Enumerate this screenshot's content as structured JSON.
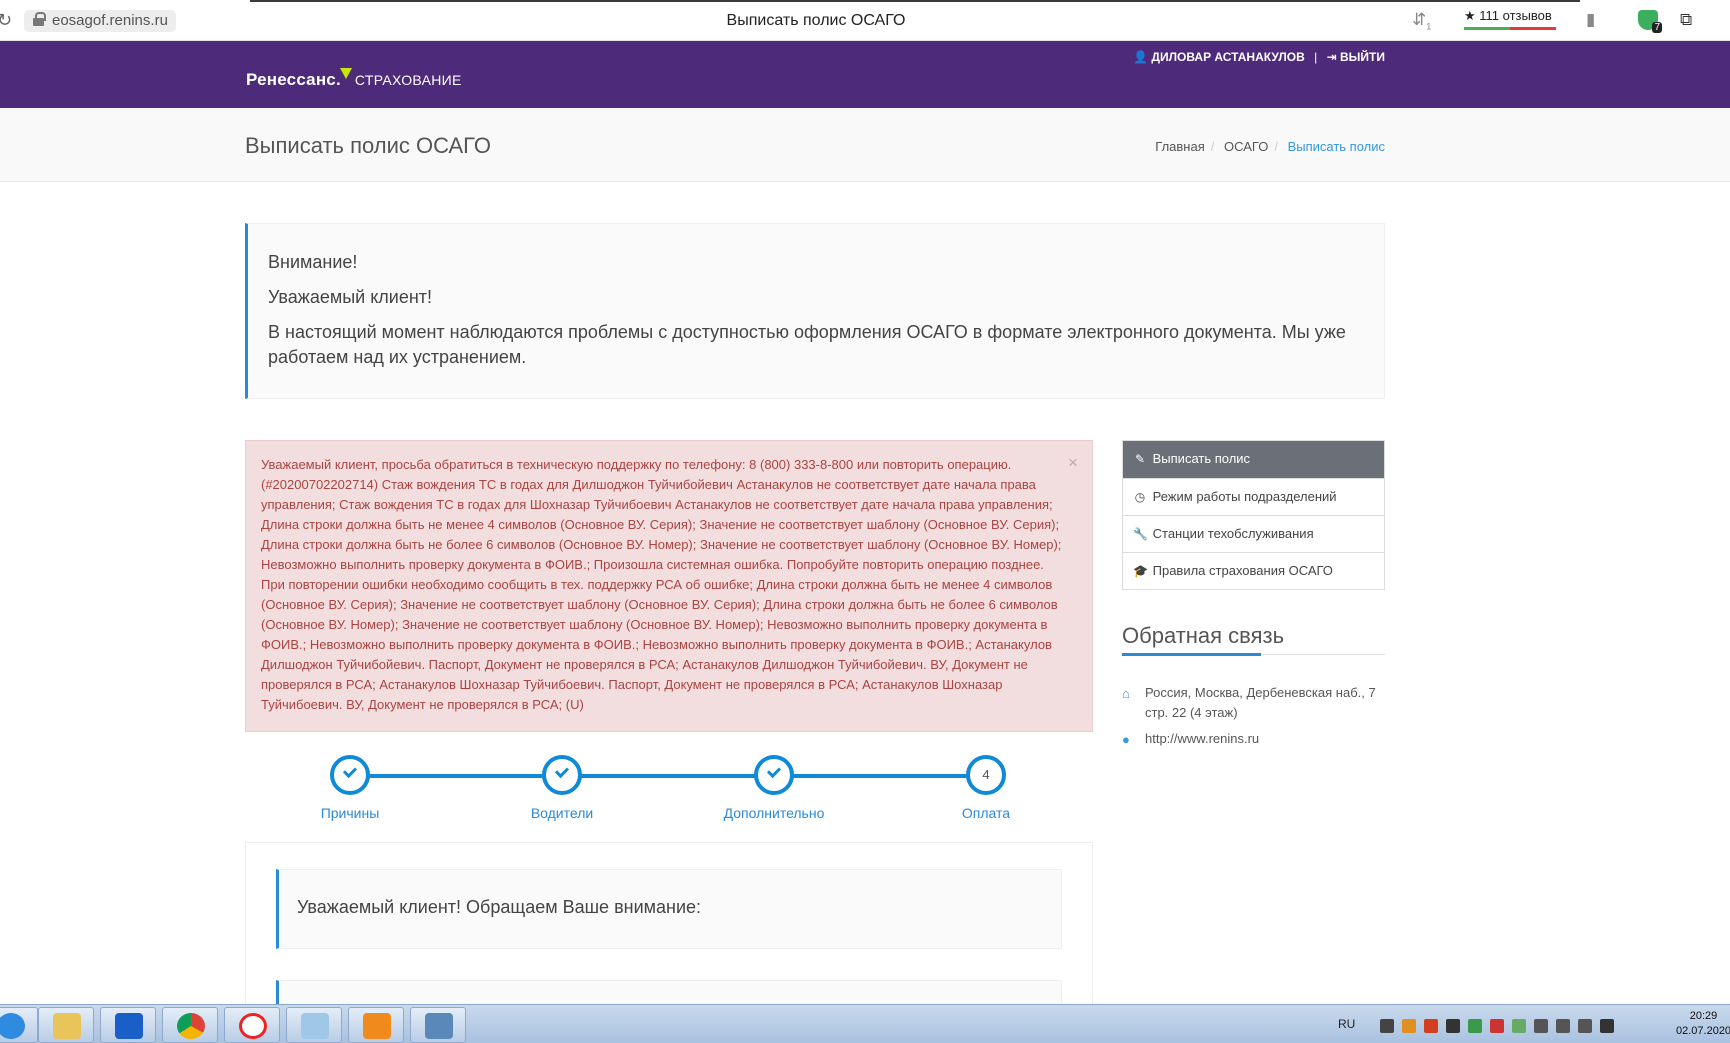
{
  "browser": {
    "url": "eosagof.renins.ru",
    "tab_title": "Выписать полис ОСАГО",
    "reviews_label": "★ 111 отзывов",
    "shield_count": "7",
    "notif_count": "1"
  },
  "header": {
    "logo_main": "Ренессанс.",
    "logo_sub": "СТРАХОВАНИЕ",
    "user_name": "ДИЛОВАР АСТАНАКУЛОВ",
    "separator": "|",
    "logout_label": "ВЫЙТИ"
  },
  "titleband": {
    "title": "Выписать полис ОСАГО",
    "breadcrumb": [
      "Главная",
      "ОСАГО",
      "Выписать полис"
    ]
  },
  "notice": {
    "line1": "Внимание!",
    "line2": "Уважаемый клиент!",
    "line3": "В настоящий момент наблюдаются проблемы с доступностью оформления ОСАГО в формате электронного документа. Мы уже работаем над их устранением."
  },
  "alert": {
    "text": "Уважаемый клиент, просьба обратиться в техническую поддержку по телефону: 8 (800) 333-8-800 или повторить операцию. (#20200702202714) Стаж вождения ТС в годах для Дилшоджон Туйчибойевич Астанакулов не соответствует дате начала права управления; Стаж вождения ТС в годах для Шохназар Туйчибоевич Астанакулов не соответствует дате начала права управления; Длина строки должна быть не менее 4 символов (Основное ВУ. Серия); Значение не соответствует шаблону (Основное ВУ. Серия); Длина строки должна быть не более 6 символов (Основное ВУ. Номер); Значение не соответствует шаблону (Основное ВУ. Номер); Невозможно выполнить проверку документа в ФОИВ.; Произошла системная ошибка. Попробуйте повторить операцию позднее. При повторении ошибки необходимо сообщить в тех. поддержку РСА об ошибке; Длина строки должна быть не менее 4 символов (Основное ВУ. Серия); Значение не соответствует шаблону (Основное ВУ. Серия); Длина строки должна быть не более 6 символов (Основное ВУ. Номер); Значение не соответствует шаблону (Основное ВУ. Номер); Невозможно выполнить проверку документа в ФОИВ.; Невозможно выполнить проверку документа в ФОИВ.; Невозможно выполнить проверку документа в ФОИВ.; Астанакулов Дилшоджон Туйчибойевич. Паспорт, Документ не проверялся в РСА; Астанакулов Дилшоджон Туйчибойевич. ВУ, Документ не проверялся в РСА; Астанакулов Шохназар Туйчибоевич. Паспорт, Документ не проверялся в РСА; Астанакулов Шохназар Туйчибоевич. ВУ, Документ не проверялся в РСА; (U)",
    "close": "×"
  },
  "steps": [
    {
      "label": "Причины",
      "done": true,
      "number": ""
    },
    {
      "label": "Водители",
      "done": true,
      "number": ""
    },
    {
      "label": "Дополнительно",
      "done": true,
      "number": ""
    },
    {
      "label": "Оплата",
      "done": false,
      "number": "4"
    }
  ],
  "panel": {
    "attention": "Уважаемый клиент! Обращаем Ваше внимание:"
  },
  "sidebar": {
    "items": [
      {
        "label": "Выписать полис",
        "icon": "edit-icon"
      },
      {
        "label": "Режим работы подразделений",
        "icon": "clock-icon"
      },
      {
        "label": "Станции техобслуживания",
        "icon": "wrench-icon"
      },
      {
        "label": "Правила страхования ОСАГО",
        "icon": "graduation-cap-icon"
      }
    ],
    "feedback_title": "Обратная связь",
    "address": "Россия, Москва, Дербеневская наб., 7 стр. 22 (4 этаж)",
    "website": "http://www.renins.ru"
  },
  "taskbar": {
    "lang": "RU",
    "time": "20:29",
    "date": "02.07.2020"
  },
  "colors": {
    "brand_purple": "#4e2a7a",
    "accent_blue": "#0f8ad8",
    "alert_bg": "#f2dede",
    "alert_text": "#a94442",
    "logo_yellow": "#c8e600"
  }
}
